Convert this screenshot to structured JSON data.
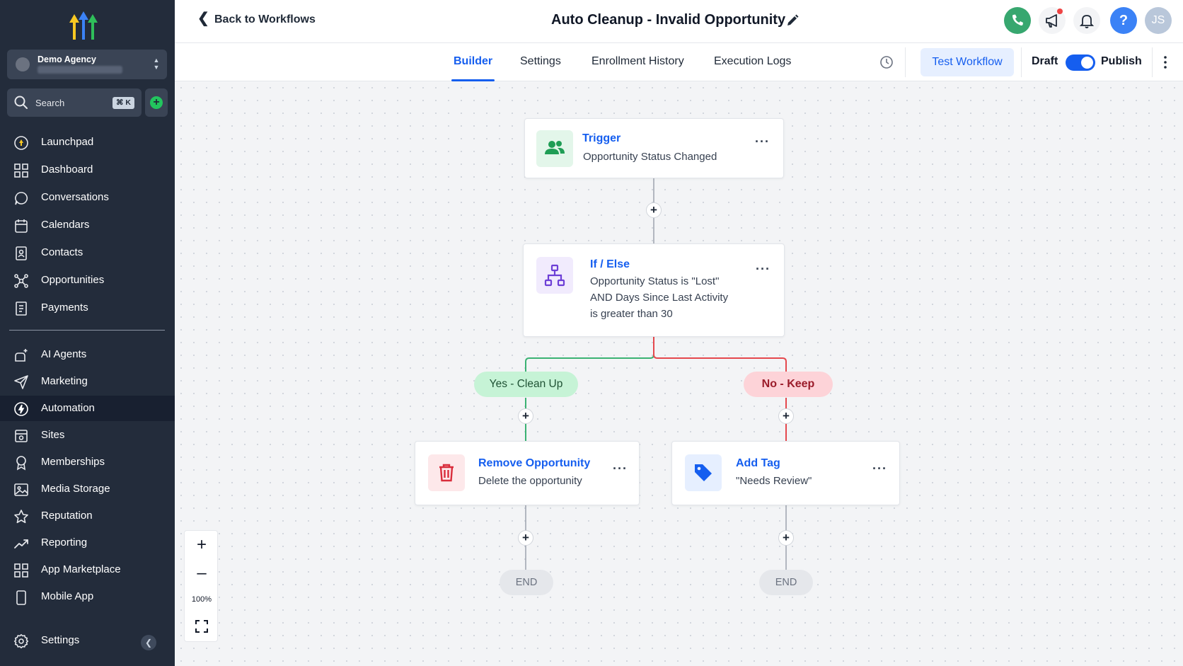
{
  "sidebar": {
    "account": {
      "name": "Demo Agency"
    },
    "search": {
      "label": "Search",
      "shortcut": "⌘ K"
    },
    "items": [
      {
        "label": "Launchpad",
        "icon": "launchpad-icon"
      },
      {
        "label": "Dashboard",
        "icon": "dashboard-icon"
      },
      {
        "label": "Conversations",
        "icon": "chat-icon"
      },
      {
        "label": "Calendars",
        "icon": "calendar-icon"
      },
      {
        "label": "Contacts",
        "icon": "contacts-icon"
      },
      {
        "label": "Opportunities",
        "icon": "opportunities-icon"
      },
      {
        "label": "Payments",
        "icon": "payments-icon"
      },
      {
        "label": "AI Agents",
        "icon": "ai-agents-icon"
      },
      {
        "label": "Marketing",
        "icon": "send-icon"
      },
      {
        "label": "Automation",
        "icon": "automation-icon",
        "active": true
      },
      {
        "label": "Sites",
        "icon": "sites-icon"
      },
      {
        "label": "Memberships",
        "icon": "memberships-icon"
      },
      {
        "label": "Media Storage",
        "icon": "image-icon"
      },
      {
        "label": "Reputation",
        "icon": "star-icon"
      },
      {
        "label": "Reporting",
        "icon": "trend-icon"
      },
      {
        "label": "App Marketplace",
        "icon": "grid-icon"
      },
      {
        "label": "Mobile App",
        "icon": "mobile-icon"
      },
      {
        "label": "Settings",
        "icon": "gear-icon"
      }
    ]
  },
  "header": {
    "back_label": "Back to Workflows",
    "title": "Auto Cleanup - Invalid Opportunity",
    "avatar_initials": "JS",
    "help_glyph": "?"
  },
  "tabs": [
    {
      "label": "Builder",
      "active": true
    },
    {
      "label": "Settings"
    },
    {
      "label": "Enrollment History"
    },
    {
      "label": "Execution Logs"
    }
  ],
  "actions": {
    "test_label": "Test Workflow",
    "draft_label": "Draft",
    "publish_label": "Publish",
    "publish_toggle_on": true
  },
  "workflow": {
    "trigger": {
      "title": "Trigger",
      "desc": "Opportunity Status Changed"
    },
    "condition": {
      "title": "If / Else",
      "desc_lines": [
        "Opportunity Status is \"Lost\"",
        "AND Days Since Last Activity",
        "is greater than 30"
      ]
    },
    "branch_yes": "Yes - Clean Up",
    "branch_no": "No - Keep",
    "action_remove": {
      "title": "Remove Opportunity",
      "desc": "Delete the opportunity"
    },
    "action_tag": {
      "title": "Add Tag",
      "desc": "\"Needs Review\""
    },
    "end_label": "END",
    "plus_glyph": "+",
    "more_glyph": "···"
  },
  "zoom": {
    "in": "+",
    "out": "–",
    "level": "100%"
  },
  "colors": {
    "brand_blue": "#155eef",
    "sidebar_bg": "#232c3b",
    "yes_green": "#3bb273",
    "no_red": "#e5484d"
  }
}
